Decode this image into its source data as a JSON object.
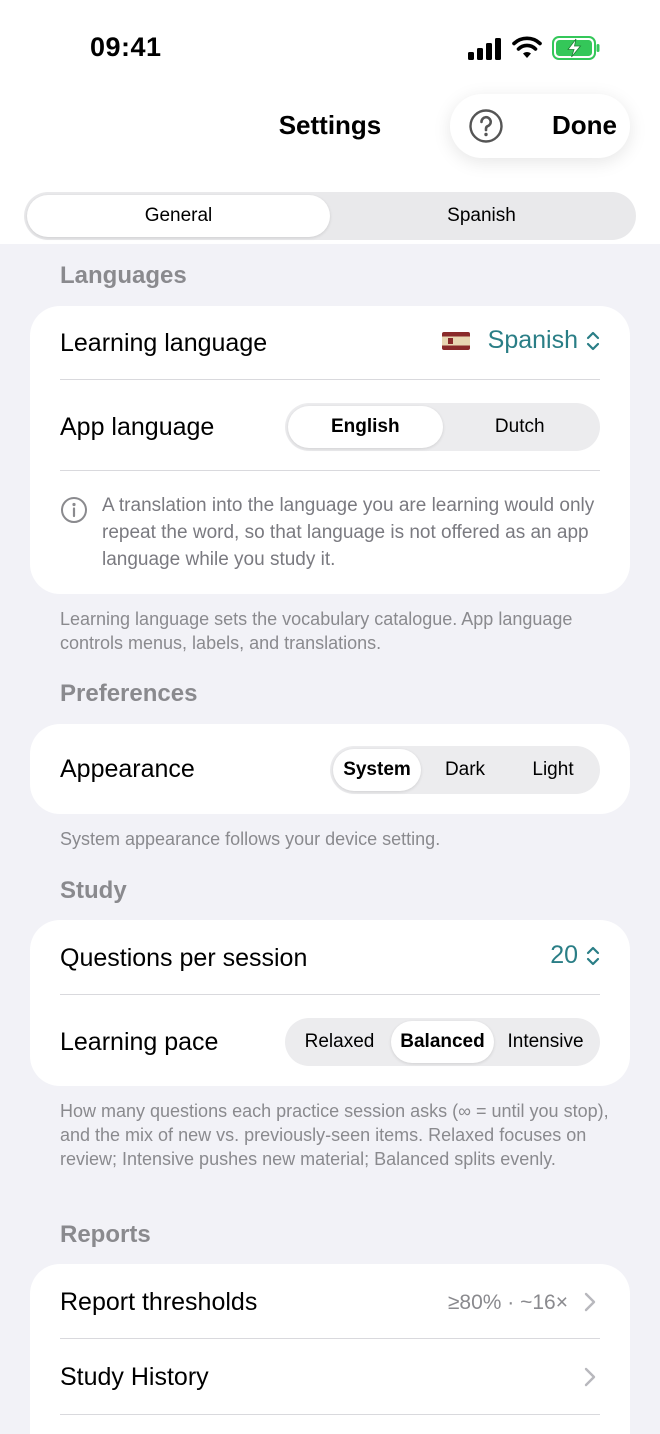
{
  "status_bar": {
    "time": "09:41"
  },
  "nav": {
    "title": "Settings",
    "done_label": "Done"
  },
  "tabs": [
    {
      "label": "General",
      "active": true
    },
    {
      "label": "Spanish",
      "active": false
    }
  ],
  "languages": {
    "section_title": "Languages",
    "learning_language_label": "Learning language",
    "learning_language_value": "Spanish",
    "app_language_label": "App language",
    "app_language_options": [
      {
        "label": "English",
        "active": true
      },
      {
        "label": "Dutch",
        "active": false
      }
    ],
    "info_text": "A translation into the language you are learning would only repeat the word, so that language is not offered as an app language while you study it.",
    "footnote": "Learning language sets the vocabulary catalogue. App language controls menus, labels, and translations."
  },
  "preferences": {
    "section_title": "Preferences",
    "appearance_label": "Appearance",
    "appearance_options": [
      {
        "label": "System",
        "active": true
      },
      {
        "label": "Dark",
        "active": false
      },
      {
        "label": "Light",
        "active": false
      }
    ],
    "footnote": "System appearance follows your device setting."
  },
  "study": {
    "section_title": "Study",
    "questions_label": "Questions per session",
    "questions_value": "20",
    "pace_label": "Learning pace",
    "pace_options": [
      {
        "label": "Relaxed",
        "active": false
      },
      {
        "label": "Balanced",
        "active": true
      },
      {
        "label": "Intensive",
        "active": false
      }
    ],
    "footnote": "How many questions each practice session asks (∞ = until you stop), and the mix of new vs. previously-seen items. Relaxed focuses on review; Intensive pushes new material; Balanced splits evenly."
  },
  "reports": {
    "section_title": "Reports",
    "thresholds_label": "Report thresholds",
    "thresholds_value": "≥80% · ~16×",
    "history_label": "Study History"
  },
  "colors": {
    "accent": "#2a7e86",
    "background": "#f2f2f7",
    "secondary_text": "#8a8a8e"
  }
}
